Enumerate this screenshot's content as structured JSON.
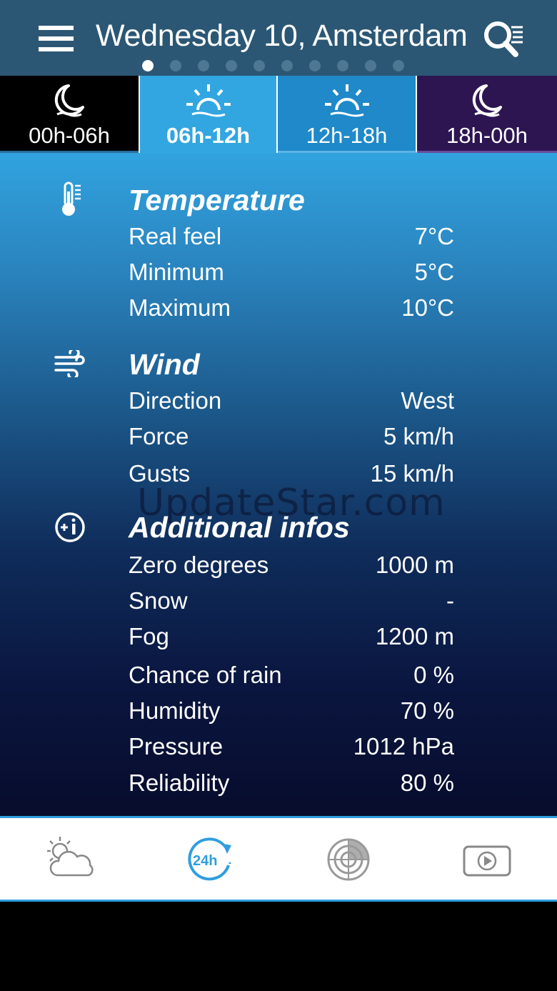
{
  "header": {
    "title": "Wednesday 10, Amsterdam",
    "page_count": 10,
    "active_page": 1
  },
  "tabs": [
    {
      "label": "00h-06h",
      "icon": "moon-icon",
      "active": false
    },
    {
      "label": "06h-12h",
      "icon": "sunrise-icon",
      "active": true
    },
    {
      "label": "12h-18h",
      "icon": "sunrise-icon",
      "active": false
    },
    {
      "label": "18h-00h",
      "icon": "moon-icon",
      "active": false
    }
  ],
  "sections": {
    "temperature": {
      "title": "Temperature",
      "rows": [
        {
          "label": "Real feel",
          "value": "7°C"
        },
        {
          "label": "Minimum",
          "value": "5°C"
        },
        {
          "label": "Maximum",
          "value": "10°C"
        }
      ]
    },
    "wind": {
      "title": "Wind",
      "rows": [
        {
          "label": "Direction",
          "value": "West"
        },
        {
          "label": "Force",
          "value": "5 km/h"
        },
        {
          "label": "Gusts",
          "value": "15 km/h"
        }
      ]
    },
    "additional": {
      "title": "Additional infos",
      "rows": [
        {
          "label": "Zero degrees",
          "value": "1000 m"
        },
        {
          "label": "Snow",
          "value": "-"
        },
        {
          "label": "Fog",
          "value": "1200 m"
        },
        {
          "label": "Chance of rain",
          "value": "0 %"
        },
        {
          "label": "Humidity",
          "value": "70 %"
        },
        {
          "label": "Pressure",
          "value": "1012 hPa"
        },
        {
          "label": "Reliability",
          "value": "80 %"
        }
      ]
    }
  },
  "watermark": "UpdateStar.com",
  "bottom_nav": [
    {
      "icon": "partly-cloudy-icon",
      "active": false
    },
    {
      "icon": "24h-forecast-icon",
      "active": true
    },
    {
      "icon": "radar-icon",
      "active": false
    },
    {
      "icon": "video-play-icon",
      "active": false
    }
  ],
  "colors": {
    "header_bg": "#2b5774",
    "active_tab": "#32a6e0",
    "accent": "#2f9ee0",
    "night_tab": "#2d1552"
  }
}
